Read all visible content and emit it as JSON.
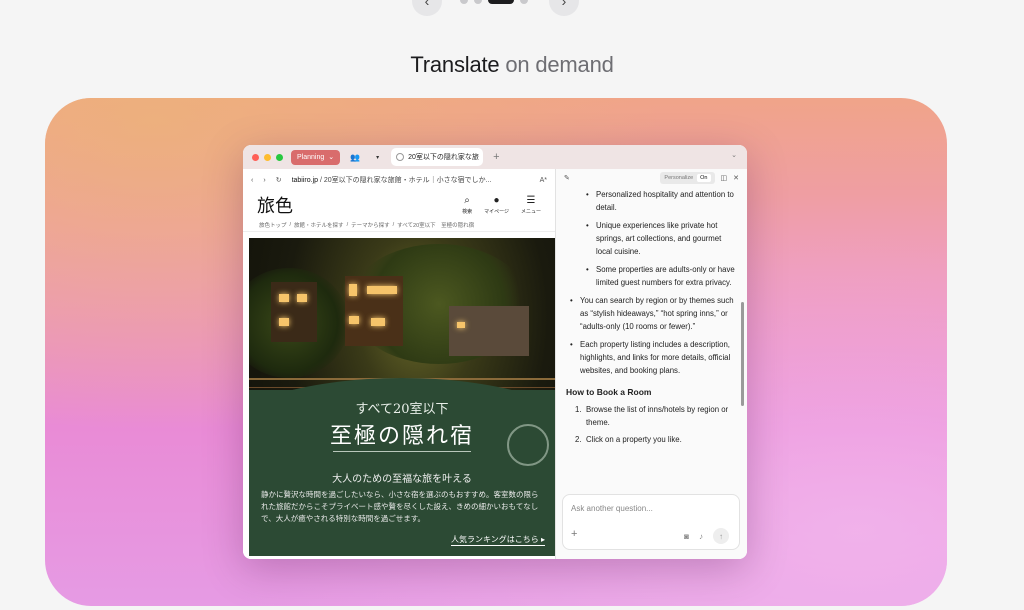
{
  "carousel": {
    "prev_icon": "chevron-left-icon",
    "next_icon": "chevron-right-icon",
    "prev_glyph": "‹",
    "next_glyph": "›"
  },
  "section": {
    "title_strong": "Translate",
    "title_light": "on demand"
  },
  "browser": {
    "tab_group": "Planning",
    "tab_group_chevron": "⌄",
    "tab_active_title": "20室以下の隠れ家な旅",
    "new_tab": "+",
    "url_domain": "tabiiro.jp",
    "url_path": " / 20室以下の隠れ家な旅館・ホテル｜小さな宿でしか...",
    "reader_glyph": "A*"
  },
  "site": {
    "logo": "旅色",
    "nav": [
      {
        "glyph": "⌕",
        "label": "検索"
      },
      {
        "glyph": "●",
        "label": "マイページ"
      },
      {
        "glyph": "☰",
        "label": "メニュー"
      }
    ],
    "breadcrumb": [
      "旅色トップ",
      "旅館・ホテルを探す",
      "テーマから探す",
      "すべて20室以下　至極の隠れ宿"
    ],
    "hero": {
      "subtitle": "すべて20室以下",
      "title": "至極の隠れ宿",
      "tagline": "大人のための至福な旅を叶える",
      "body": "静かに贅沢な時間を過ごしたいなら、小さな宿を選ぶのもおすすめ。客室数の限られた旅館だからこそプライベート感や贅を尽くした設え、きめの細かいおもてなしで、大人が癒やされる特別な時間を過ごせます。",
      "link": "人気ランキングはこちら ▸"
    }
  },
  "assistant": {
    "personalize_label": "Personalize",
    "personalize_state": "On",
    "sub_bullets": [
      "Personalized hospitality and attention to detail.",
      "Unique experiences like private hot springs, art collections, and gourmet local cuisine.",
      "Some properties are adults-only or have limited guest numbers for extra privacy."
    ],
    "main_bullets": [
      "You can search by region or by themes such as “stylish hideaways,” “hot spring inns,” or “adults-only (10 rooms or fewer).”",
      "Each property listing includes a description, highlights, and links for more details, official websites, and booking plans."
    ],
    "booking_heading": "How to Book a Room",
    "steps": [
      {
        "num": "1.",
        "text": "Browse the list of inns/hotels by region or theme."
      },
      {
        "num": "2.",
        "text": "Click on a property you like."
      }
    ],
    "ask_placeholder": "Ask another question..."
  }
}
